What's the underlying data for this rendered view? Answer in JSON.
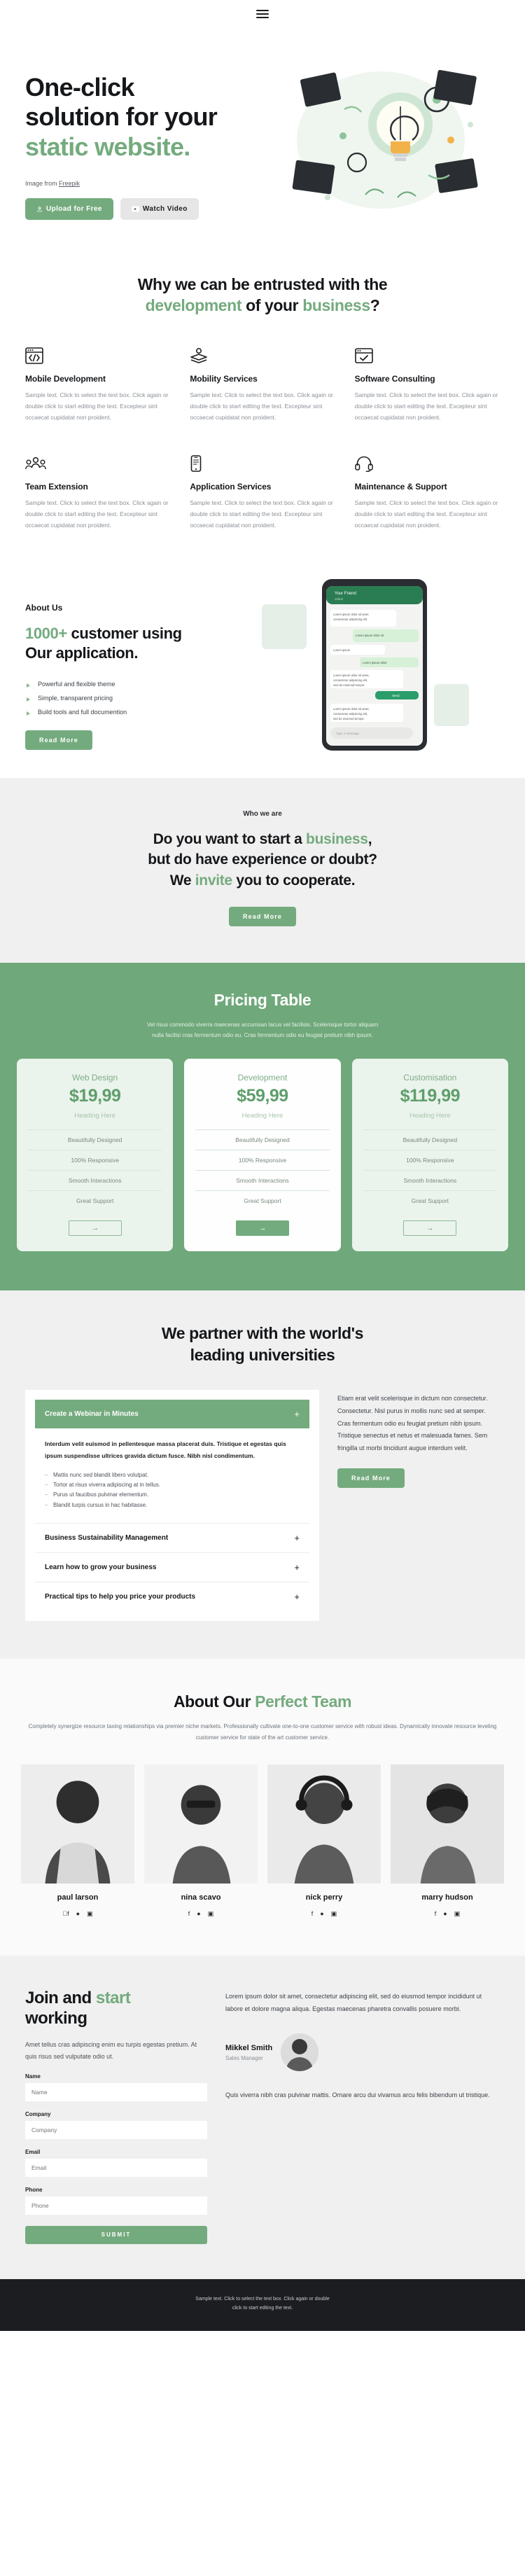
{
  "nav": {
    "menu_icon": "hamburger-menu-icon"
  },
  "hero": {
    "title_line1": "One-click",
    "title_line2": "solution for your",
    "title_accent": "static website.",
    "credit_prefix": "Image from ",
    "credit_link": "Freepik",
    "primary_button": "Upload for Free",
    "primary_icon": "upload-icon",
    "secondary_button": "Watch Video",
    "secondary_icon": "play-icon",
    "illustration": "lightbulb-idea-illustration"
  },
  "features": {
    "title_part1": "Why we can be entrusted with the",
    "title_accent1": "development",
    "title_part2": " of your ",
    "title_accent2": "business",
    "title_part3": "?",
    "body": "Sample text. Click to select the text box. Click again or double click to start editing the text. Excepteur sint occaecat cupidatat non proident.",
    "items": [
      {
        "icon": "code-window-icon",
        "title": "Mobile Development"
      },
      {
        "icon": "layers-gear-icon",
        "title": "Mobility Services"
      },
      {
        "icon": "browser-check-icon",
        "title": "Software Consulting"
      },
      {
        "icon": "people-group-icon",
        "title": "Team Extension"
      },
      {
        "icon": "mobile-phone-icon",
        "title": "Application Services"
      },
      {
        "icon": "headset-support-icon",
        "title": "Maintenance & Support"
      }
    ]
  },
  "about": {
    "kicker": "About Us",
    "head_accent": "1000+",
    "head_rest1": " customer using",
    "head_rest2": "Our application.",
    "list": [
      "Powerful and flexible theme",
      "Simple, transparent pricing",
      "Build tools and full documention"
    ],
    "button": "Read More",
    "illustration": "chat-app-phone-mockup"
  },
  "whowe": {
    "kicker": "Who we are",
    "line1_a": "Do you want to start a ",
    "line1_accent": "business",
    "line1_b": ",",
    "line2": "but do have experience or doubt?",
    "line3_a": "We ",
    "line3_accent": "invite",
    "line3_b": " you to cooperate.",
    "button": "Read More"
  },
  "pricing": {
    "title": "Pricing Table",
    "subtitle_line1": "Vel risus commodo viverra maecenas accumsan lacus vel facilisis. Scelerisque tortor aliquam",
    "subtitle_line2": "nulla facilisi cras fermentum odio eu. Cras fermentum odio eu feugiat pretium nibh ipsum.",
    "heading_label": "Heading Here",
    "arrow_icon": "arrow-right-icon",
    "features": [
      "Beautifully Designed",
      "100% Responsive",
      "Smooth Interactions",
      "Great Support"
    ],
    "plans": [
      {
        "name": "Web Design",
        "price": "$19,99",
        "highlight": false
      },
      {
        "name": "Development",
        "price": "$59,99",
        "highlight": true
      },
      {
        "name": "Customisation",
        "price": "$119,99",
        "highlight": false
      }
    ]
  },
  "universities": {
    "title_line1": "We partner with the world's",
    "title_line2": "leading universities",
    "accordion": [
      {
        "title": "Create a Webinar in Minutes",
        "open": true,
        "lead": "Interdum velit euismod in pellentesque massa placerat duis. Tristique et egestas quis ipsum suspendisse ultrices gravida dictum fusce. Nibh nisl condimentum.",
        "bullets": [
          "Mattis nunc sed blandit libero volutpat.",
          "Tortor at risus viverra adipiscing at in tellus.",
          "Purus ut faucibus pulvinar elementum.",
          "Blandit turpis cursus in hac habitasse."
        ]
      },
      {
        "title": "Business Sustainability Management",
        "open": false
      },
      {
        "title": "Learn how to grow your business",
        "open": false
      },
      {
        "title": "Practical tips to help you price your products",
        "open": false
      }
    ],
    "plus_icon": "plus-icon",
    "right_paragraph": "Etiam erat velit scelerisque in dictum non consectetur. Consectetur. Nisl purus in mollis nunc sed at semper. Cras fermentum odio eu feugiat pretium nibh ipsum. Tristique senectus et netus et malesuada fames. Sem fringilla ut morbi tincidunt augue interdum velit.",
    "button": "Read More"
  },
  "team": {
    "title_part1": "About Our ",
    "title_accent": "Perfect Team",
    "subtitle": "Completely synergize resource taxing relationships via premier niche markets. Professionally cultivate one-to-one customer service with robust ideas. Dynamically innovate resource leveling customer service for state of the art customer service.",
    "social_icons": [
      "facebook-icon",
      "twitter-icon",
      "instagram-icon"
    ],
    "members": [
      {
        "name": "paul larson",
        "photo": "portrait-man-seated"
      },
      {
        "name": "nina scavo",
        "photo": "portrait-woman-glasses"
      },
      {
        "name": "nick perry",
        "photo": "portrait-man-headphones"
      },
      {
        "name": "marry hudson",
        "photo": "portrait-woman-seated"
      }
    ]
  },
  "contact": {
    "title_part1": "Join and ",
    "title_accent": "start",
    "title_part2": "working",
    "intro": "Amet tellus cras adipiscing enim eu turpis egestas pretium. At quis risus sed vulputate odio ut.",
    "fields": [
      {
        "label": "Name",
        "placeholder": "Name",
        "value": ""
      },
      {
        "label": "Company",
        "placeholder": "Company",
        "value": ""
      },
      {
        "label": "Email",
        "placeholder": "Email",
        "value": ""
      },
      {
        "label": "Phone",
        "placeholder": "Phone",
        "value": ""
      }
    ],
    "submit": "SUBMIT",
    "right_paragraph": "Lorem ipsum dolor sit amet, consectetur adipiscing elit, sed do eiusmod tempor incididunt ut labore et dolore magna aliqua. Egestas maecenas pharetra convallis posuere morbi.",
    "person_name": "Mikkel Smith",
    "person_role": "Sales Manager",
    "person_photo": "portrait-sales-manager",
    "right_paragraph2": "Quis viverra nibh cras pulvinar mattis. Ornare arcu dui vivamus arcu felis bibendum ut tristique."
  },
  "footer": {
    "line1": "Sample text. Click to select the text box. Click again or double",
    "line2": "click to start editing the text."
  }
}
